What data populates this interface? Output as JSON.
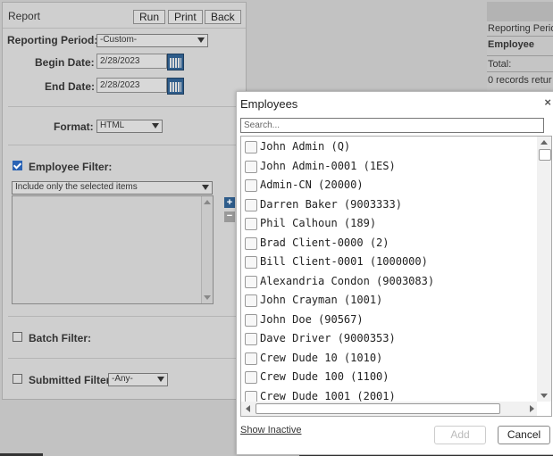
{
  "report": {
    "title": "Report",
    "run_label": "Run",
    "print_label": "Print",
    "back_label": "Back",
    "reporting_period_label": "Reporting Period:",
    "reporting_period_value": "-Custom-",
    "begin_date_label": "Begin Date:",
    "begin_date_value": "2/28/2023",
    "end_date_label": "End Date:",
    "end_date_value": "2/28/2023",
    "format_label": "Format:",
    "format_value": "HTML",
    "employee_filter_label": "Employee Filter:",
    "employee_filter_checked": true,
    "employee_filter_mode": "Include only the selected items",
    "add_symbol": "+",
    "remove_symbol": "−",
    "batch_filter_label": "Batch Filter:",
    "submitted_filter_label": "Submitted Filter:",
    "submitted_filter_value": "-Any-"
  },
  "background_table": {
    "rows": [
      "Reporting Perio",
      "Employee",
      "Total:",
      "0 records retur"
    ]
  },
  "dialog": {
    "title": "Employees",
    "close_symbol": "×",
    "search_placeholder": "Search...",
    "employees": [
      "John Admin (Q)",
      "John Admin-0001 (1ES)",
      "Admin-CN (20000)",
      "Darren Baker (9003333)",
      "Phil Calhoun (189)",
      "Brad Client-0000 (2)",
      "Bill Client-0001 (1000000)",
      "Alexandria Condon (9003083)",
      "John Crayman (1001)",
      "John Doe (90567)",
      "Dave Driver (9000353)",
      "Crew Dude 10 (1010)",
      "Crew Dude 100 (1100)",
      "Crew Dude 1001 (2001)"
    ],
    "show_inactive_label": "Show Inactive",
    "add_label": "Add",
    "cancel_label": "Cancel"
  }
}
